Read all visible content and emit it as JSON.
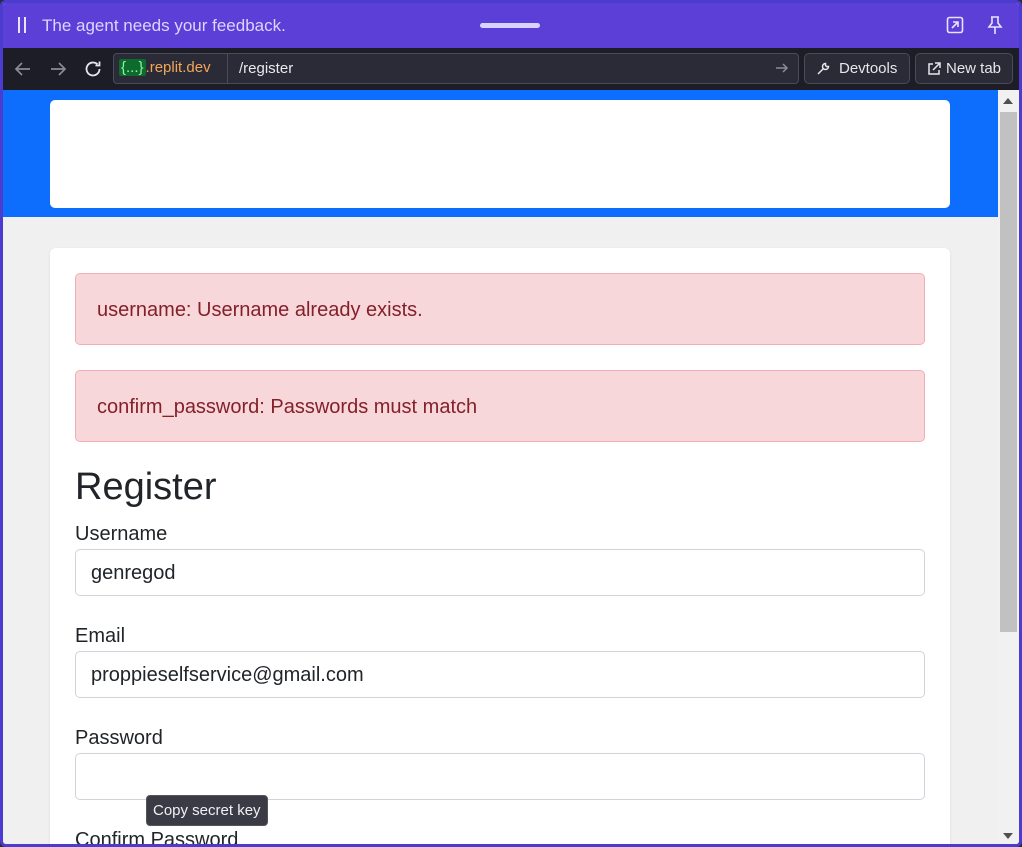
{
  "agent_bar": {
    "message": "The agent needs your feedback.",
    "background_color": "#5b3fd6"
  },
  "browser": {
    "url_host_braces": "{...}",
    "url_host_domain": ".replit.dev",
    "url_path": "/register",
    "devtools_label": "Devtools",
    "new_tab_label": "New tab"
  },
  "page": {
    "hero_color": "#0d6efd",
    "errors": [
      "username: Username already exists.",
      "confirm_password: Passwords must match"
    ],
    "title": "Register",
    "fields": [
      {
        "label": "Username",
        "value": "genregod"
      },
      {
        "label": "Email",
        "value": "proppieselfservice@gmail.com"
      },
      {
        "label": "Password",
        "value": ""
      },
      {
        "label": "Confirm Password",
        "value": ""
      }
    ],
    "tooltip": "Copy secret key"
  }
}
